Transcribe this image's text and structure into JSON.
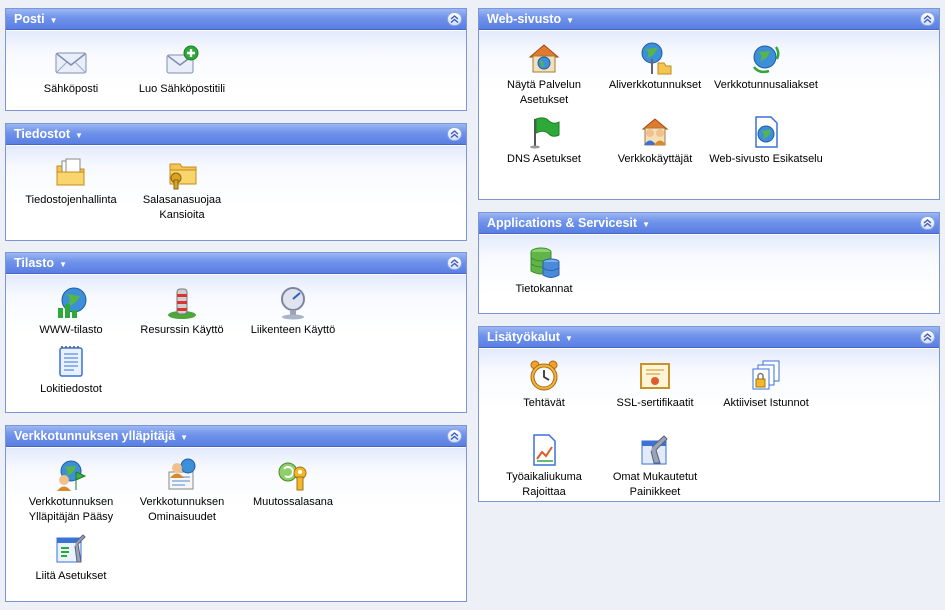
{
  "panels": {
    "posti": {
      "title": "Posti",
      "items": [
        {
          "label": "Sähköposti",
          "icon": "envelope-icon"
        },
        {
          "label": "Luo Sähköpostitili",
          "icon": "add-email-icon"
        }
      ]
    },
    "tiedostot": {
      "title": "Tiedostot",
      "items": [
        {
          "label": "Tiedostojenhallinta",
          "icon": "file-manager-icon"
        },
        {
          "label": "Salasanasuojaa Kansioita",
          "icon": "password-folder-icon"
        }
      ]
    },
    "tilasto": {
      "title": "Tilasto",
      "items": [
        {
          "label": "WWW-tilasto",
          "icon": "web-stats-icon"
        },
        {
          "label": "Resurssin Käyttö",
          "icon": "resource-usage-icon"
        },
        {
          "label": "Liikenteen Käyttö",
          "icon": "traffic-usage-icon"
        },
        {
          "label": "Lokitiedostot",
          "icon": "log-files-icon"
        }
      ]
    },
    "yllapitaja": {
      "title": "Verkkotunnuksen ylläpitäjä",
      "items": [
        {
          "label": "Verkkotunnuksen Ylläpitäjän Pääsy",
          "icon": "admin-access-icon"
        },
        {
          "label": "Verkkotunnuksen Ominaisuudet",
          "icon": "domain-properties-icon"
        },
        {
          "label": "Muutossalasana",
          "icon": "change-password-icon"
        },
        {
          "label": "Liitä Asetukset",
          "icon": "attach-settings-icon"
        }
      ]
    },
    "websivusto": {
      "title": "Web-sivusto",
      "items": [
        {
          "label": "Näytä Palvelun Asetukset",
          "icon": "service-settings-icon"
        },
        {
          "label": "Aliverkkotunnukset",
          "icon": "subdomains-icon"
        },
        {
          "label": "Verkkotunnusaliakset",
          "icon": "domain-aliases-icon"
        },
        {
          "label": "DNS Asetukset",
          "icon": "dns-flag-icon"
        },
        {
          "label": "Verkkokäyttäjät",
          "icon": "web-users-icon"
        },
        {
          "label": "Web-sivusto Esikatselu",
          "icon": "site-preview-icon"
        }
      ]
    },
    "applications": {
      "title": "Applications & Servicesit",
      "items": [
        {
          "label": "Tietokannat",
          "icon": "database-icon"
        }
      ]
    },
    "lisatyokalut": {
      "title": "Lisätyökalut",
      "items": [
        {
          "label": "Tehtävät",
          "icon": "alarm-clock-icon"
        },
        {
          "label": "SSL-sertifikaatit",
          "icon": "certificate-icon"
        },
        {
          "label": "Aktiiviset Istunnot",
          "icon": "active-sessions-icon"
        },
        {
          "label": "Työaikaliukuma Rajoittaa",
          "icon": "timeline-chart-icon"
        },
        {
          "label": "Omat Mukautetut Painikkeet",
          "icon": "custom-buttons-icon"
        }
      ]
    }
  }
}
